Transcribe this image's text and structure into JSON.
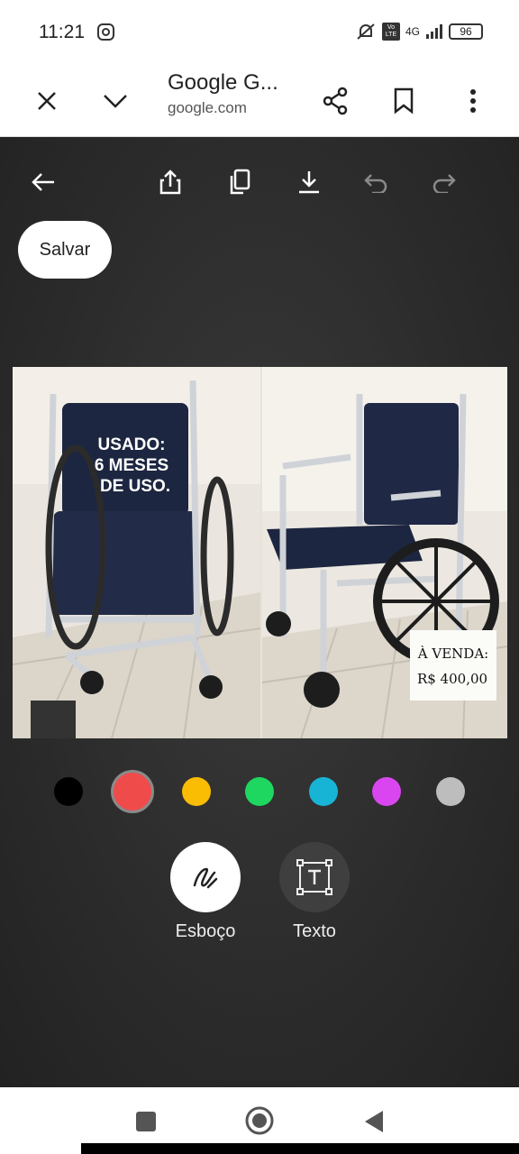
{
  "status_bar": {
    "time": "11:21",
    "network": "4G",
    "volte": "Vo LTE",
    "battery": "96"
  },
  "toolbar": {
    "title": "Google G...",
    "url": "google.com"
  },
  "editor": {
    "save_label": "Salvar",
    "photo": {
      "left_caption_lines": [
        "USADO:",
        "6 MESES",
        "DE USO."
      ],
      "right_sign_lines": [
        "À VENDA:",
        "R$ 400,00"
      ]
    },
    "colors": [
      "#000000",
      "#f04b4b",
      "#fbbc04",
      "#1ed760",
      "#18b4d6",
      "#d946ef",
      "#bdbdbd"
    ],
    "selected_color": "#f04b4b",
    "tools": [
      {
        "label": "Esboço",
        "icon": "pen-scribble-icon",
        "active": true
      },
      {
        "label": "Texto",
        "icon": "text-box-icon",
        "active": false
      }
    ]
  }
}
